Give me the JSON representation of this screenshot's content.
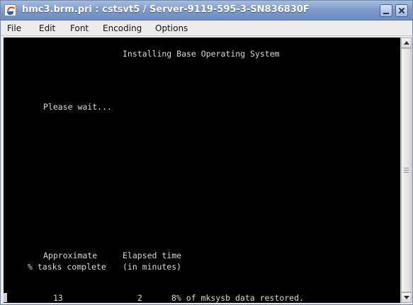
{
  "window": {
    "title": "hmc3.brm.pri : cstsvt5 / Server-9119-595-3-SN836830F"
  },
  "menu": {
    "items": [
      {
        "label": "File"
      },
      {
        "label": "Edit"
      },
      {
        "label": "Font"
      },
      {
        "label": "Encoding"
      },
      {
        "label": "Options"
      }
    ]
  },
  "terminal": {
    "heading": "Installing Base Operating System",
    "wait_message": "Please wait...",
    "col1_header_line1": "Approximate",
    "col1_header_line2": "% tasks complete",
    "col2_header_line1": "Elapsed time",
    "col2_header_line2": "(in minutes)",
    "percent_complete": "13",
    "elapsed_minutes": "2",
    "status_message": "8% of mksysb data restored."
  },
  "colors": {
    "terminal_background": "#000000",
    "terminal_text": "#d8d8d8",
    "titlebar": "#7f9ccb",
    "menubar": "#ececec"
  },
  "icons": {
    "app": "java-coffee-cup-icon",
    "minimize": "minimize-icon",
    "close": "close-icon",
    "scroll_up": "arrow-up-icon",
    "scroll_down": "arrow-down-icon"
  }
}
